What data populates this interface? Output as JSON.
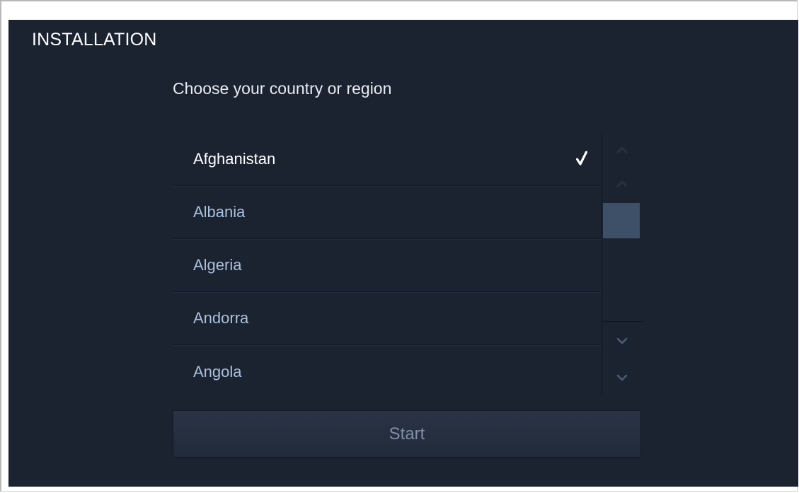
{
  "header": {
    "title": "INSTALLATION"
  },
  "prompt": {
    "text": "Choose your country or region"
  },
  "country_list": {
    "items": [
      {
        "label": "Afghanistan",
        "selected": true
      },
      {
        "label": "Albania",
        "selected": false
      },
      {
        "label": "Algeria",
        "selected": false
      },
      {
        "label": "Andorra",
        "selected": false
      },
      {
        "label": "Angola",
        "selected": false
      }
    ],
    "selected_icon": "checkmark-icon"
  },
  "scrollbar": {
    "icons": [
      "page-up-icon",
      "scroll-up-icon",
      "scroll-down-icon",
      "page-down-icon"
    ]
  },
  "actions": {
    "start_label": "Start"
  },
  "colors": {
    "background": "#1b2230",
    "item_text": "#a9c1dd",
    "selected_text": "#ffffff",
    "scroll_thumb": "#3e4f68"
  }
}
